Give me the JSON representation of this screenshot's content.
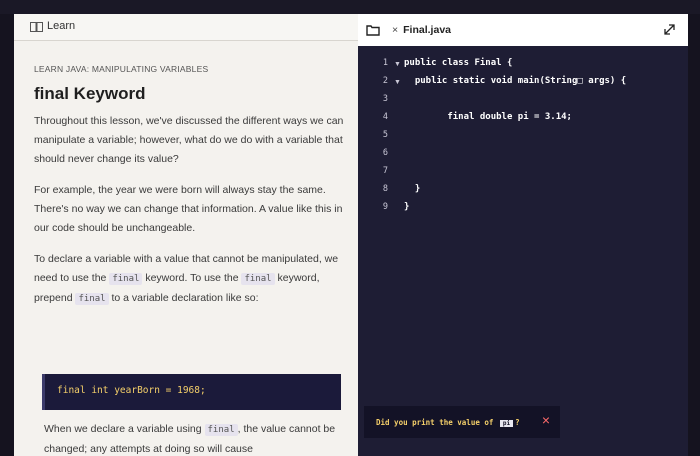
{
  "left_header": {
    "label": "Learn"
  },
  "lesson": {
    "eyebrow": "LEARN JAVA: MANIPULATING VARIABLES",
    "title": "final Keyword",
    "para1": "Throughout this lesson, we've discussed the different ways we can manipulate a variable; however, what do we do with a variable that should never change its value?",
    "para2": "For example, the year we were born will always stay the same. There's no way we can change that information. A value like this in our code should be unchangeable.",
    "para3_a": "To declare a variable with a value that cannot be manipulated, we need to use the",
    "para3_code1": "final",
    "para3_b": "keyword. To use the",
    "para3_code2": "final",
    "para3_c": "keyword, prepend",
    "para3_code3": "final",
    "para3_d": "to a variable declaration like so:",
    "code_block": "final int yearBorn = 1968;",
    "para4_a": "When we declare a variable using",
    "para4_code": "final",
    "para4_b": ", the value cannot be changed; any attempts at doing so will cause"
  },
  "editor": {
    "tab_close": "×",
    "tab_label": "Final.java",
    "line_numbers": [
      "1",
      "2",
      "3",
      "4",
      "5",
      "6",
      "7",
      "8",
      "9"
    ],
    "lines": [
      "public class Final {",
      "  public static void main(String□ args) {",
      "",
      "        final double pi = 3.14;",
      "",
      "",
      "",
      "  }",
      "}"
    ]
  },
  "tooltip": {
    "text_a": "Did you print the value of",
    "text_pi": "pi",
    "text_b": "?",
    "close": "×"
  },
  "colors": {
    "code_bg": "#1e1d34",
    "accent_yellow": "#f5d06a",
    "close_red": "#ff6b6b"
  }
}
